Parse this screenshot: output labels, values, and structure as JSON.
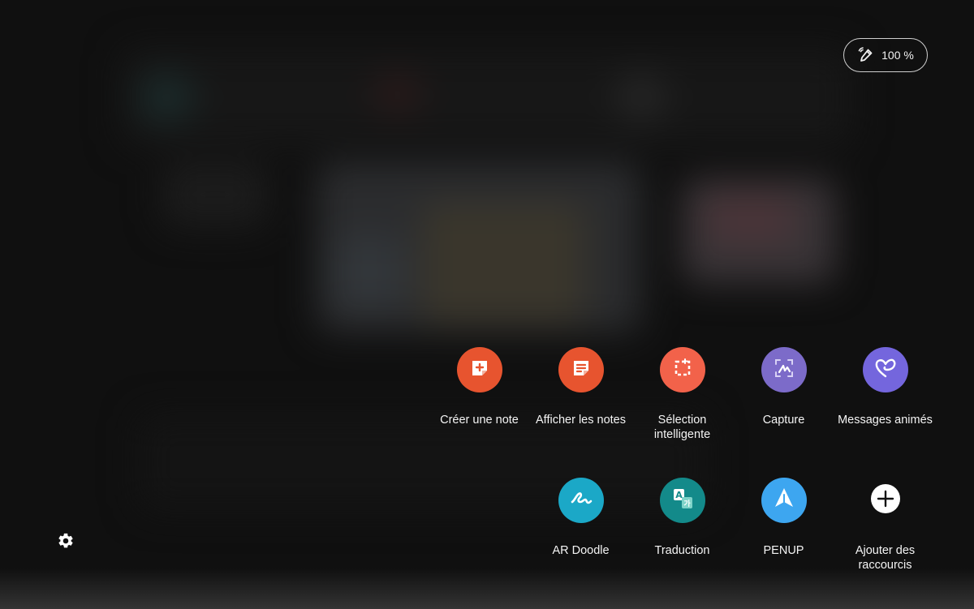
{
  "battery": {
    "value": "100 %",
    "icon": "pen-battery-icon"
  },
  "shortcuts": [
    {
      "label": "Créer une note",
      "color": "#e7542f",
      "icon": "create-note-icon"
    },
    {
      "label": "Afficher les notes",
      "color": "#e7542f",
      "icon": "view-notes-icon"
    },
    {
      "label": "Sélection intelligente",
      "color": "#f2624a",
      "icon": "smart-select-icon"
    },
    {
      "label": "Capture",
      "color": "#7c6bc9",
      "icon": "capture-write-icon"
    },
    {
      "label": "Messages animés",
      "color": "#7466dd",
      "icon": "heart-icon"
    },
    {
      "label": "AR Doodle",
      "color": "#1ba8c7",
      "icon": "ar-doodle-icon"
    },
    {
      "label": "Traduction",
      "color": "#138a8a",
      "icon": "translate-icon"
    },
    {
      "label": "PENUP",
      "color": "#3da6f0",
      "icon": "penup-icon"
    },
    {
      "label": "Ajouter des raccourcis",
      "color": "#ffffff",
      "icon": "add-icon"
    }
  ],
  "settings": {
    "icon": "gear-icon"
  }
}
